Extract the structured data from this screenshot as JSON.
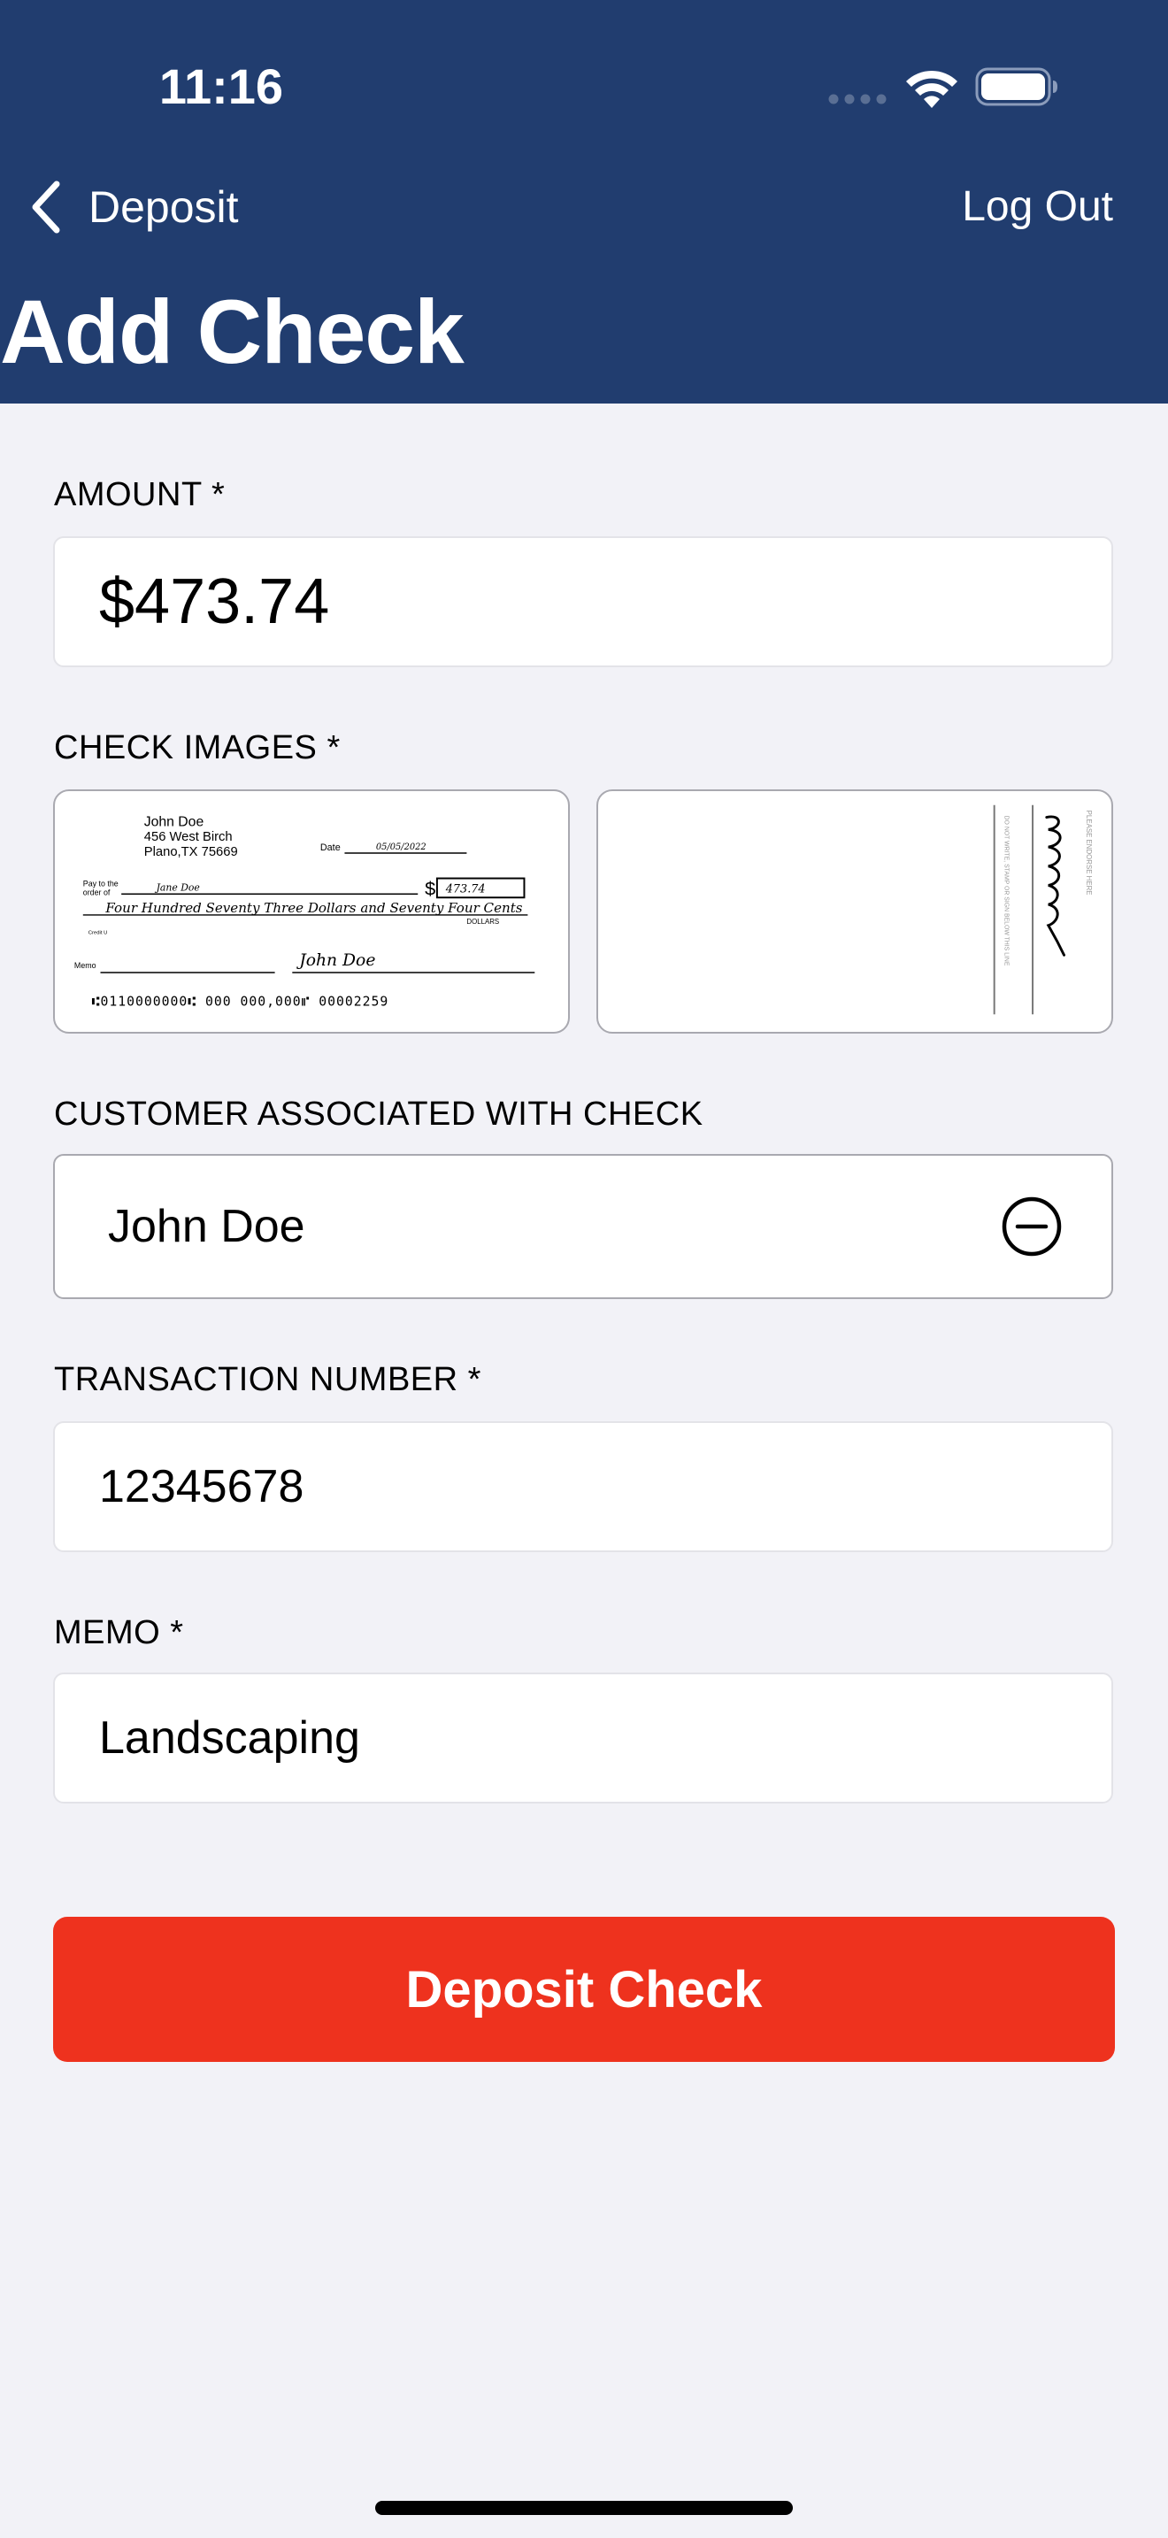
{
  "status_bar": {
    "time": "11:16"
  },
  "nav": {
    "back_label": "Deposit",
    "logout_label": "Log Out",
    "title": "Add Check"
  },
  "form": {
    "amount_label": "AMOUNT *",
    "amount_value": "$473.74",
    "check_images_label": "CHECK IMAGES *",
    "front_check": {
      "payer_name": "John Doe",
      "payer_address1": "456 West Birch",
      "payer_address2": "Plano,TX 75669",
      "date_label": "Date",
      "date_value": "05/05/2022",
      "pay_to_label1": "Pay to the",
      "pay_to_label2": "order of",
      "payee": "Jane Doe",
      "amount_box": "473.74",
      "written_amount": "Four Hundred Seventy Three Dollars and Seventy Four Cents",
      "dollars_label": "DOLLARS",
      "bank_label": "Credit U",
      "memo_label": "Memo",
      "signature": "John Doe",
      "micr": "⑆0110000000⑆ 000 000,000⑈ 00002259"
    },
    "back_check": {
      "endorse_label": "PLEASE ENDORSE HERE",
      "do_not_write": "DO NOT WRITE, STAMP OR SIGN BELOW THIS LINE"
    },
    "customer_label": "CUSTOMER ASSOCIATED WITH CHECK",
    "customer_name": "John Doe",
    "transaction_label": "TRANSACTION NUMBER *",
    "transaction_value": "12345678",
    "memo_label": "MEMO *",
    "memo_value": "Landscaping",
    "submit_label": "Deposit Check"
  },
  "icons": {
    "back": "chevron-left-icon",
    "remove": "minus-circle-icon",
    "wifi": "wifi-icon",
    "battery": "battery-icon",
    "signal": "signal-icon"
  },
  "colors": {
    "header_bg": "#213d6f",
    "accent_red": "#ee321e",
    "page_bg": "#f2f2f7"
  }
}
